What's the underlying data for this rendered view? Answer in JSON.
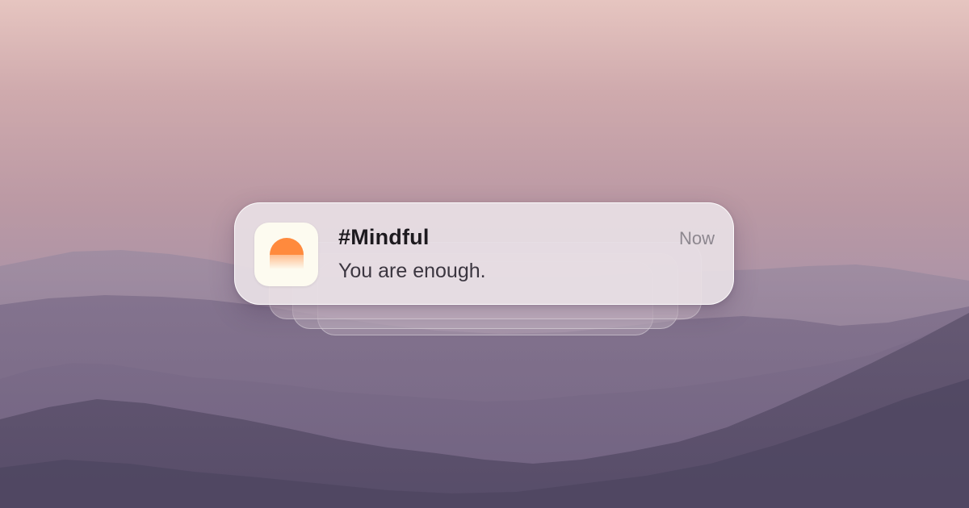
{
  "notification": {
    "app_icon": "sunrise-icon",
    "title": "#Mindful",
    "message": "You are enough.",
    "time": "Now"
  },
  "colors": {
    "icon_sun": "#ff8a3d",
    "icon_background": "#fdfbf0",
    "sky_top": "#e6c5c0",
    "mountains": "#5e5272"
  }
}
